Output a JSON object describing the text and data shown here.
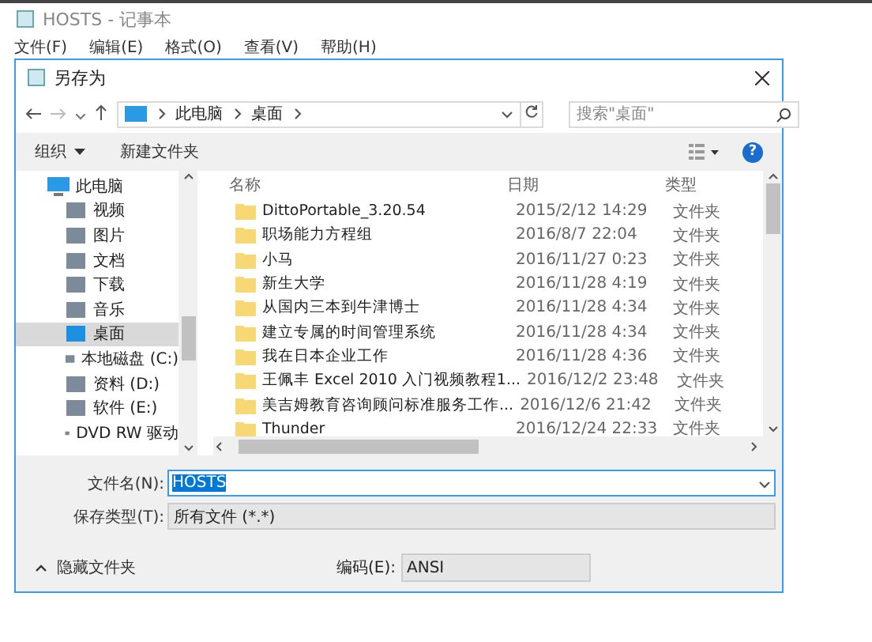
{
  "window": {
    "title": "HOSTS - 记事本"
  },
  "menu": [
    "文件(F)",
    "编辑(E)",
    "格式(O)",
    "查看(V)",
    "帮助(H)"
  ],
  "dialog": {
    "title": "另存为",
    "breadcrumb": [
      "此电脑",
      "桌面"
    ],
    "search": {
      "placeholder": "搜索\"桌面\""
    },
    "toolbar": {
      "organize": "组织",
      "new_folder": "新建文件夹",
      "help": "?"
    },
    "nav": [
      {
        "label": "此电脑",
        "selected": false,
        "children": [
          {
            "label": "视频",
            "selected": false
          },
          {
            "label": "图片",
            "selected": false
          },
          {
            "label": "文档",
            "selected": false
          },
          {
            "label": "下载",
            "selected": false
          },
          {
            "label": "音乐",
            "selected": false
          },
          {
            "label": "桌面",
            "selected": true
          },
          {
            "label": "本地磁盘 (C:)",
            "selected": false
          },
          {
            "label": "资料 (D:)",
            "selected": false
          },
          {
            "label": "软件 (E:)",
            "selected": false
          },
          {
            "label": "DVD RW 驱动",
            "selected": false
          }
        ]
      }
    ],
    "columns": [
      "名称",
      "日期",
      "类型"
    ],
    "files": [
      {
        "name": "DittoPortable_3.20.54",
        "date": "2015/2/12 14:29",
        "type": "文件夹"
      },
      {
        "name": "职场能力方程组",
        "date": "2016/8/7 22:04",
        "type": "文件夹"
      },
      {
        "name": "小马",
        "date": "2016/11/27 0:23",
        "type": "文件夹"
      },
      {
        "name": "新生大学",
        "date": "2016/11/28 4:19",
        "type": "文件夹"
      },
      {
        "name": "从国内三本到牛津博士",
        "date": "2016/11/28 4:34",
        "type": "文件夹"
      },
      {
        "name": "建立专属的时间管理系统",
        "date": "2016/11/28 4:34",
        "type": "文件夹"
      },
      {
        "name": "我在日本企业工作",
        "date": "2016/11/28 4:36",
        "type": "文件夹"
      },
      {
        "name": "王佩丰 Excel 2010 入门视频教程1...",
        "date": "2016/12/2 23:48",
        "type": "文件夹"
      },
      {
        "name": "美吉姆教育咨询顾问标准服务工作...",
        "date": "2016/12/6 21:42",
        "type": "文件夹"
      },
      {
        "name": "Thunder",
        "date": "2016/12/24 22:33",
        "type": "文件夹"
      }
    ],
    "filename": {
      "label": "文件名(N):",
      "value": "HOSTS"
    },
    "filetype": {
      "label": "保存类型(T):",
      "value": "所有文件 (*.*)"
    },
    "hide_folders": "隐藏文件夹",
    "encoding": {
      "label": "编码(E):",
      "value": "ANSI"
    }
  }
}
